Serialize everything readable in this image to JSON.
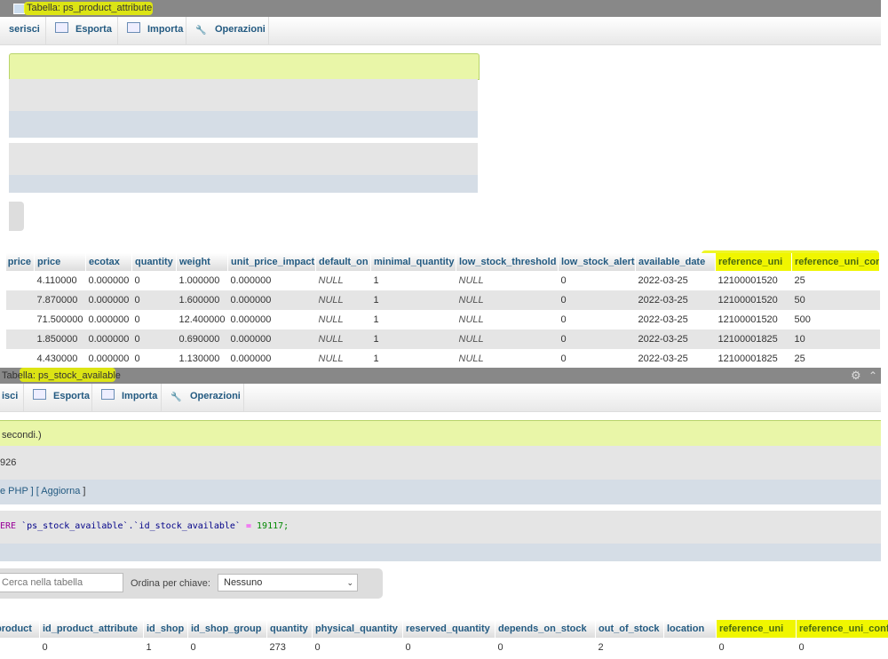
{
  "panel1": {
    "title": "Tabella: ps_product_attribute",
    "tabs": [
      {
        "label": "serisci",
        "icon": "insert-icon"
      },
      {
        "label": "Esporta",
        "icon": "export-icon"
      },
      {
        "label": "Importa",
        "icon": "import-icon"
      },
      {
        "label": "Operazioni",
        "icon": "wrench-icon"
      }
    ],
    "columns": [
      "price",
      "price",
      "ecotax",
      "quantity",
      "weight",
      "unit_price_impact",
      "default_on",
      "minimal_quantity",
      "low_stock_threshold",
      "low_stock_alert",
      "available_date",
      "reference_uni",
      "reference_uni_conf"
    ],
    "rows": [
      [
        "",
        "4.110000",
        "0.000000",
        "0",
        "1.000000",
        "0.000000",
        "NULL",
        "1",
        "NULL",
        "0",
        "2022-03-25",
        "12100001520",
        "25"
      ],
      [
        "",
        "7.870000",
        "0.000000",
        "0",
        "1.600000",
        "0.000000",
        "NULL",
        "1",
        "NULL",
        "0",
        "2022-03-25",
        "12100001520",
        "50"
      ],
      [
        "",
        "71.500000",
        "0.000000",
        "0",
        "12.400000",
        "0.000000",
        "NULL",
        "1",
        "NULL",
        "0",
        "2022-03-25",
        "12100001520",
        "500"
      ],
      [
        "",
        "1.850000",
        "0.000000",
        "0",
        "0.690000",
        "0.000000",
        "NULL",
        "1",
        "NULL",
        "0",
        "2022-03-25",
        "12100001825",
        "10"
      ],
      [
        "",
        "4.430000",
        "0.000000",
        "0",
        "1.130000",
        "0.000000",
        "NULL",
        "1",
        "NULL",
        "0",
        "2022-03-25",
        "12100001825",
        "25"
      ]
    ]
  },
  "panel2": {
    "title": "Tabella: ps_stock_available",
    "tabs": [
      {
        "label": "isci",
        "icon": "insert-icon"
      },
      {
        "label": "Esporta",
        "icon": "export-icon"
      },
      {
        "label": "Importa",
        "icon": "import-icon"
      },
      {
        "label": "Operazioni",
        "icon": "wrench-icon"
      }
    ],
    "message": "secondi.)",
    "row_count_fragment": "926",
    "links_prefix": "e PHP ] [",
    "link_refresh": "Aggiorna",
    "links_suffix": "]",
    "sql_keyword": "ERE",
    "sql_body": "`ps_stock_available`.`id_stock_available`",
    "sql_op": "=",
    "sql_value": "19117;",
    "search_placeholder": "Cerca nella tabella",
    "sort_label": "Ordina per chiave:",
    "sort_value": "Nessuno",
    "columns": [
      "product",
      "id_product_attribute",
      "id_shop",
      "id_shop_group",
      "quantity",
      "physical_quantity",
      "reserved_quantity",
      "depends_on_stock",
      "out_of_stock",
      "location",
      "reference_uni",
      "reference_uni_conf"
    ],
    "rows": [
      [
        "",
        "0",
        "1",
        "0",
        "273",
        "0",
        "0",
        "0",
        "2",
        "",
        "0",
        "0"
      ]
    ]
  },
  "highlight_color": "#f0f600"
}
